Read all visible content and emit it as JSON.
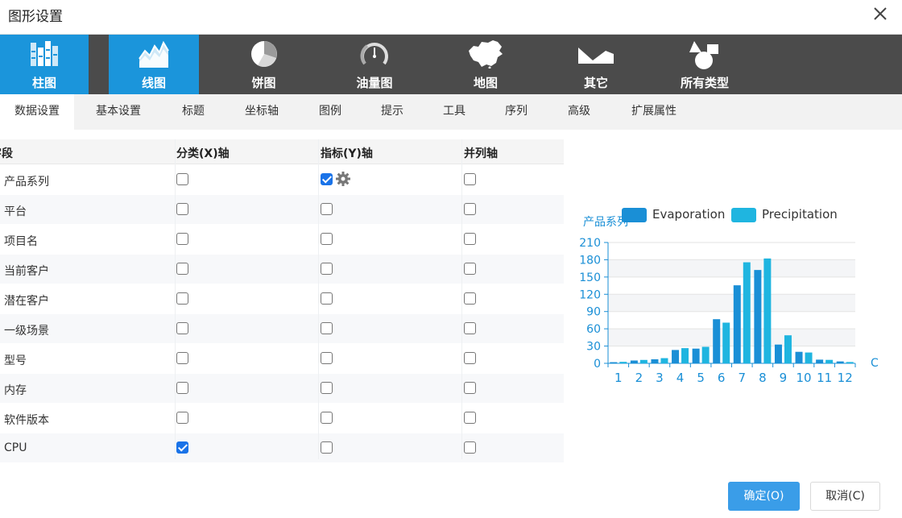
{
  "dialog": {
    "title": "图形设置"
  },
  "chart_types": [
    {
      "label": "柱图",
      "icon": "bar-chart-icon",
      "active": true
    },
    {
      "label": "线图",
      "icon": "area-chart-icon",
      "active": true
    },
    {
      "label": "饼图",
      "icon": "pie-chart-icon",
      "active": false
    },
    {
      "label": "油量图",
      "icon": "gauge-icon",
      "active": false
    },
    {
      "label": "地图",
      "icon": "china-map-icon",
      "active": false
    },
    {
      "label": "其它",
      "icon": "mountain-icon",
      "active": false
    },
    {
      "label": "所有类型",
      "icon": "shapes-icon",
      "active": false
    }
  ],
  "tabs": [
    "数据设置",
    "基本设置",
    "标题",
    "坐标轴",
    "图例",
    "提示",
    "工具",
    "序列",
    "高级",
    "扩展属性"
  ],
  "grid": {
    "headers": {
      "field": "字段",
      "x_axis": "分类(X)轴",
      "y_axis": "指标(Y)轴",
      "parallel": "并列轴"
    },
    "rows": [
      {
        "name": "产品系列",
        "x": false,
        "y": true,
        "p": false,
        "gear": true
      },
      {
        "name": "平台",
        "x": false,
        "y": false,
        "p": false
      },
      {
        "name": "项目名",
        "x": false,
        "y": false,
        "p": false
      },
      {
        "name": "当前客户",
        "x": false,
        "y": false,
        "p": false
      },
      {
        "name": "潜在客户",
        "x": false,
        "y": false,
        "p": false
      },
      {
        "name": "一级场景",
        "x": false,
        "y": false,
        "p": false
      },
      {
        "name": "型号",
        "x": false,
        "y": false,
        "p": false
      },
      {
        "name": "内存",
        "x": false,
        "y": false,
        "p": false
      },
      {
        "name": "软件版本",
        "x": false,
        "y": false,
        "p": false
      },
      {
        "name": "CPU",
        "x": true,
        "y": false,
        "p": false
      }
    ]
  },
  "chart_data": {
    "type": "bar",
    "ylabel": "产品系列",
    "xlabel": "C",
    "categories": [
      "1",
      "2",
      "3",
      "4",
      "5",
      "6",
      "7",
      "8",
      "9",
      "10",
      "11",
      "12"
    ],
    "ylim": [
      0,
      210
    ],
    "yticks": [
      "0",
      "30",
      "60",
      "90",
      "120",
      "150",
      "180",
      "210"
    ],
    "legend_position": "top",
    "series": [
      {
        "name": "Evaporation",
        "color": "#1a8fd6",
        "values": [
          2.0,
          4.9,
          7.0,
          23.2,
          25.6,
          76.7,
          135.6,
          162.2,
          32.6,
          20.0,
          6.4,
          3.3
        ]
      },
      {
        "name": "Precipitation",
        "color": "#1fb5e0",
        "values": [
          2.6,
          5.9,
          9.0,
          26.4,
          28.7,
          70.7,
          175.6,
          182.2,
          48.7,
          18.8,
          6.0,
          2.3
        ]
      }
    ]
  },
  "buttons": {
    "ok": "确定(O)",
    "cancel": "取消(C)"
  }
}
